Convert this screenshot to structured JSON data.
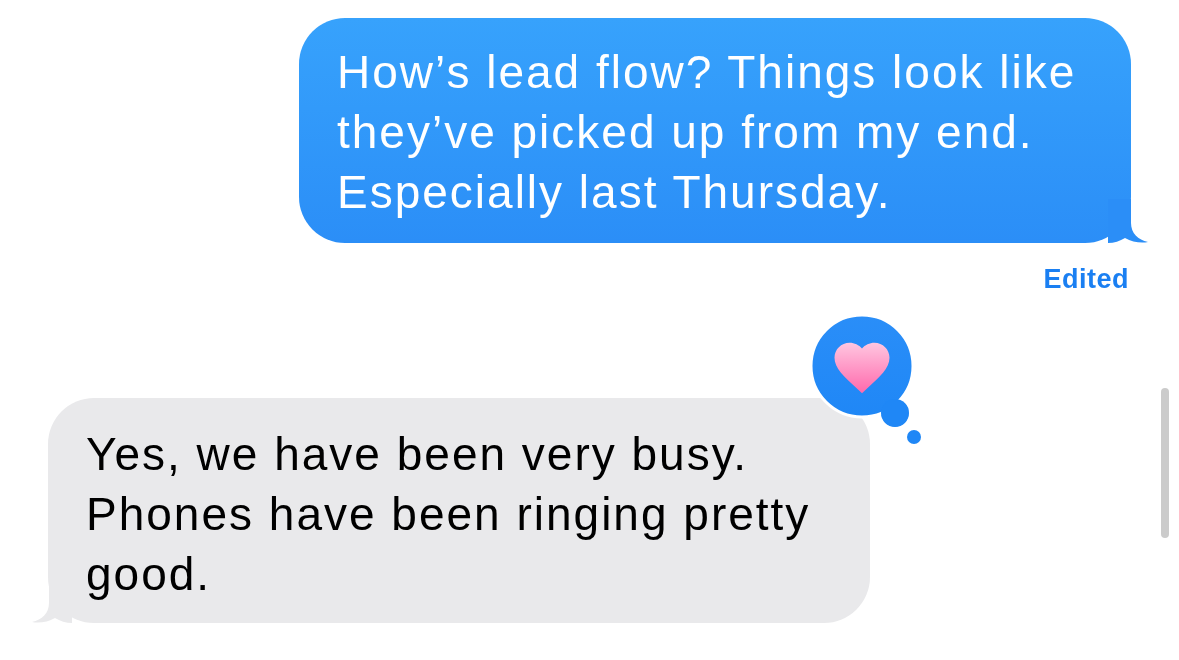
{
  "messages": [
    {
      "kind": "sent",
      "text": "How’s lead flow? Things look like they’ve picked up from my end. Especially last Thursday.",
      "status": "Edited"
    },
    {
      "kind": "received",
      "text": "Yes, we have been very busy. Phones have been ringing pretty good.",
      "reacted": true
    }
  ]
}
